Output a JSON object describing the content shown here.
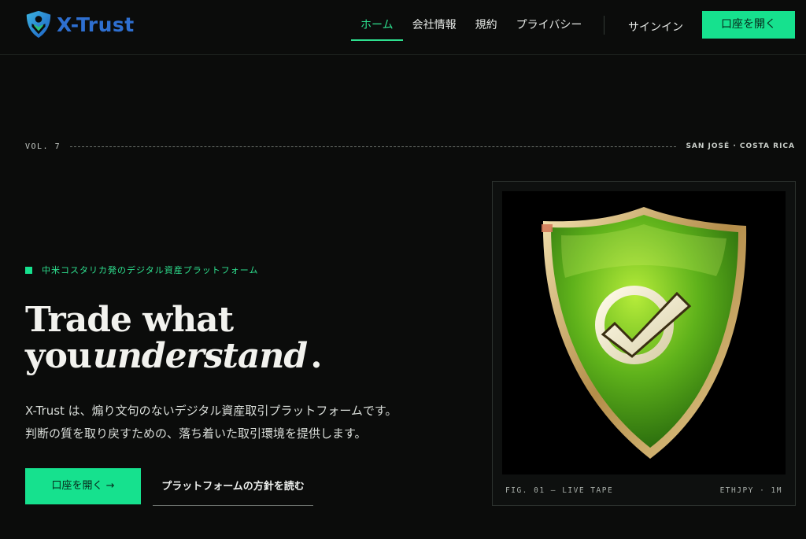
{
  "brand": {
    "name": "X-Trust",
    "logo_icon": "shield-person-icon",
    "color": "#2e6fd0"
  },
  "nav": {
    "items": [
      {
        "label": "ホーム",
        "active": true
      },
      {
        "label": "会社情報",
        "active": false
      },
      {
        "label": "規約",
        "active": false
      },
      {
        "label": "プライバシー",
        "active": false
      }
    ],
    "signin": "サインイン",
    "open_account": "口座を開く"
  },
  "meta": {
    "volume": "VOL. 7",
    "location": "SAN JOSÉ · COSTA RICA"
  },
  "hero": {
    "tagline": "中米コスタリカ発のデジタル資産プラットフォーム",
    "headline_line1": "Trade what",
    "headline_line2_prefix": "you",
    "headline_emphasis": "understand",
    "headline_suffix": ".",
    "description_line1": "X-Trust は、煽り文句のないデジタル資産取引プラットフォームです。",
    "description_line2": "判断の質を取り戻すための、落ち着いた取引環境を提供します。",
    "cta_label": "口座を開く →",
    "secondary_label": "プラットフォームの方針を読む"
  },
  "figure": {
    "image_icon": "green-shield-checkmark-icon",
    "caption": "FIG. 01 — LIVE TAPE",
    "ticker": "ETHJPY · 1M"
  },
  "colors": {
    "accent": "#16e18e",
    "accent_text": "#2ee08f",
    "background": "#0b0c0b"
  }
}
